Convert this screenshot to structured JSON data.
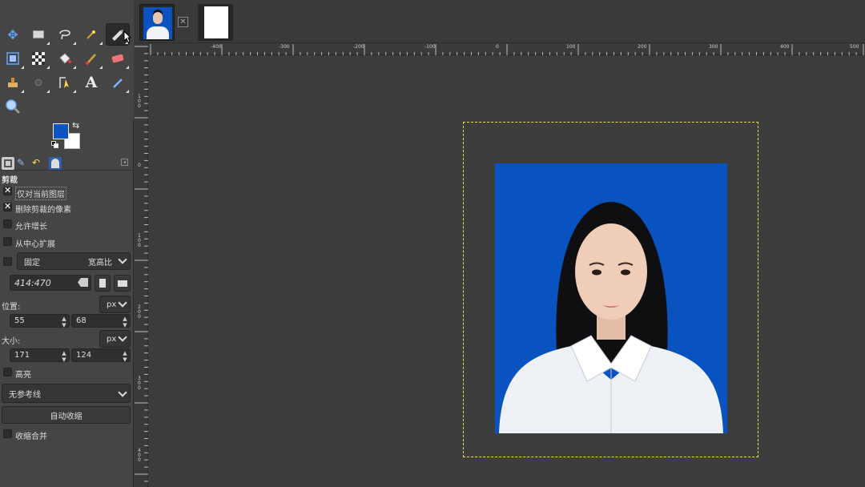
{
  "colors": {
    "foreground": "#0b54c1",
    "background": "#ffffff",
    "accent_dash": "#e8e04a"
  },
  "toolbox": {
    "tools": [
      "move-icon",
      "rect-select-icon",
      "lasso-icon",
      "fuzzy-select-icon",
      "crop-icon",
      "unified-transform-icon",
      "warp-icon",
      "bucket-fill-icon",
      "paintbrush-icon",
      "eraser-icon",
      "clone-icon",
      "smudge-icon",
      "paths-icon",
      "text-icon",
      "color-picker-icon",
      "zoom-icon"
    ]
  },
  "tool_options": {
    "title": "剪裁",
    "current_layer_only": "仅对当前图层",
    "delete_cropped": "删除剪裁的像素",
    "allow_growing": "允许增长",
    "expand_center": "从中心扩展",
    "fixed_label": "固定",
    "fixed_mode": "宽高比",
    "aspect_value": "414:470",
    "position_label": "位置:",
    "position_unit": "px",
    "position_x": "55",
    "position_y": "68",
    "size_label": "大小:",
    "size_unit": "px",
    "size_w": "171",
    "size_h": "124",
    "highlight": "高亮",
    "guides": "无参考线",
    "auto_shrink": "自动收缩",
    "shrink_merged": "收缩合并"
  },
  "ruler": {
    "h_labels": [
      "-400",
      "-300",
      "-200",
      "-100",
      "0",
      "100",
      "200",
      "300",
      "400",
      "500"
    ],
    "v_labels": [
      "100",
      "0",
      "100",
      "200",
      "300",
      "400"
    ]
  }
}
